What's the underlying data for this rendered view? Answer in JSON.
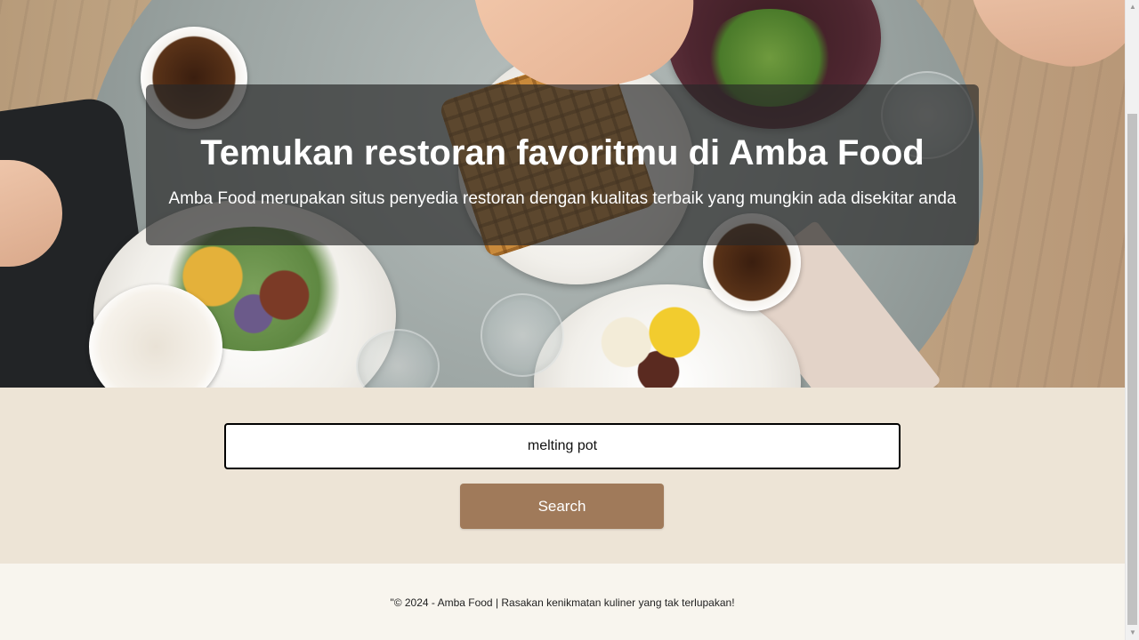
{
  "hero": {
    "title": "Temukan restoran favoritmu di Amba Food",
    "subtitle": "Amba Food merupakan situs penyedia restoran dengan kualitas terbaik yang mungkin ada disekitar anda",
    "overlay_color": "#282828"
  },
  "search": {
    "input_value": "melting pot",
    "button_label": "Search",
    "button_color": "#a07a5a",
    "section_background": "#ede4d6"
  },
  "footer": {
    "text": "\"© 2024 - Amba Food | Rasakan kenikmatan kuliner yang tak terlupakan!",
    "background": "#f8f5ee"
  },
  "scrollbar": {
    "up_arrow": "▲",
    "down_arrow": "▼"
  }
}
